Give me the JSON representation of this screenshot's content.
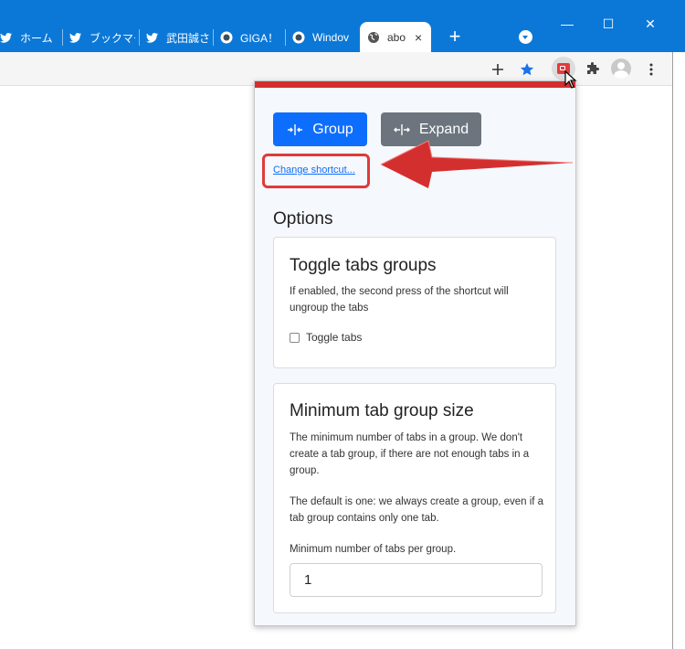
{
  "browser": {
    "tabs": [
      {
        "icon": "twitter-icon",
        "label": "ホーム / T"
      },
      {
        "icon": "twitter-icon",
        "label": "ブックマー"
      },
      {
        "icon": "twitter-icon",
        "label": "武田誠さ"
      },
      {
        "icon": "site-icon",
        "label": "GIGA！"
      },
      {
        "icon": "site-icon",
        "label": "Windov"
      },
      {
        "icon": "globe-icon",
        "label": "abo",
        "active": true
      }
    ],
    "new_tab": "+",
    "close_tab": "×",
    "window_controls": {
      "minimize": "—",
      "maximize": "☐",
      "close": "✕"
    },
    "accent_color": "#0b78d7"
  },
  "toolbar": {
    "icons": [
      "add-icon",
      "star-icon",
      "extension-tab-group-icon",
      "puzzle-icon",
      "profile-avatar",
      "menu-dots-icon"
    ]
  },
  "popup": {
    "group_label": "Group",
    "expand_label": "Expand",
    "change_shortcut": "Change shortcut...",
    "options_title": "Options",
    "toggle_card": {
      "title": "Toggle tabs groups",
      "description": "If enabled, the second press of the shortcut will ungroup the tabs",
      "checkbox_label": "Toggle tabs",
      "checked": false
    },
    "min_card": {
      "title": "Minimum tab group size",
      "description1": "The minimum number of tabs in a group. We don't create a tab group, if there are not enough tabs in a group.",
      "description2": "The default is one: we always create a group, even if a tab group contains only one tab.",
      "input_label": "Minimum number of tabs per group.",
      "input_value": "1"
    },
    "colors": {
      "primary": "#0d6efd",
      "secondary": "#6c757d",
      "accent": "#d32f2f"
    }
  }
}
